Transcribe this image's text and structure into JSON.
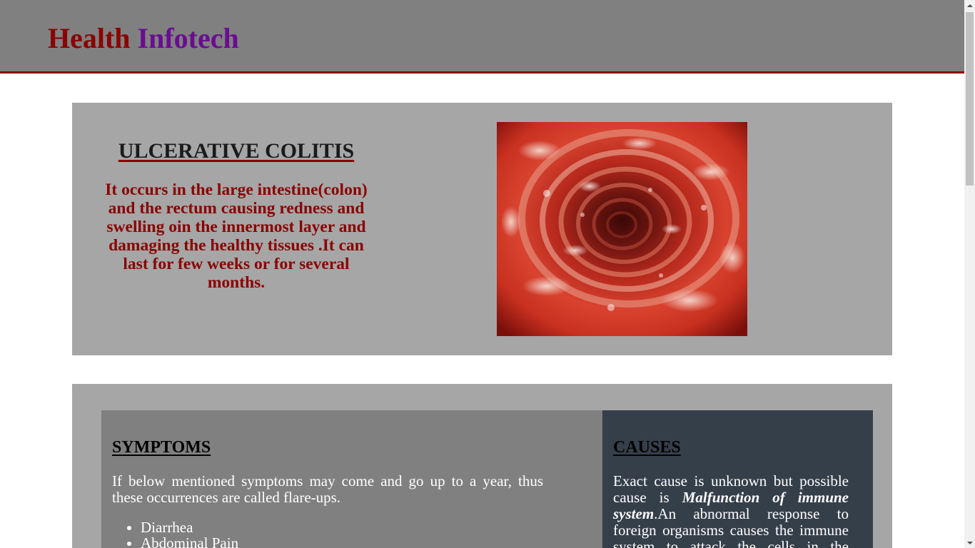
{
  "header": {
    "brand_part1": "Health",
    "brand_part2": "Infotech"
  },
  "hero": {
    "title": "ULCERATIVE COLITIS",
    "description": "It occurs in the large intestine(colon) and the rectum causing redness and swelling oin the innermost layer and damaging the healthy tissues .It can last for few weeks or for several months.",
    "image_name": "colon-endoscopy-image"
  },
  "symptoms": {
    "title": "SYMPTOMS",
    "text": "If below mentioned symptoms may come and go up to a year, thus these occurrences are called flare-ups.",
    "items": [
      "Diarrhea",
      "Abdominal Pain"
    ]
  },
  "causes": {
    "title": "CAUSES",
    "text_before": "Exact cause is unknown but possible cause is ",
    "text_emphasis": "Malfunction of immune system",
    "text_after": ".An abnormal response to foreign organisms causes the immune system to attack the cells in the digestive tract."
  },
  "colors": {
    "header_bg": "#808080",
    "accent_dark_red": "#8b0000",
    "brand_purple": "#6a0d91",
    "panel_grey": "#a6a6a6",
    "causes_bg": "#353f4a"
  }
}
